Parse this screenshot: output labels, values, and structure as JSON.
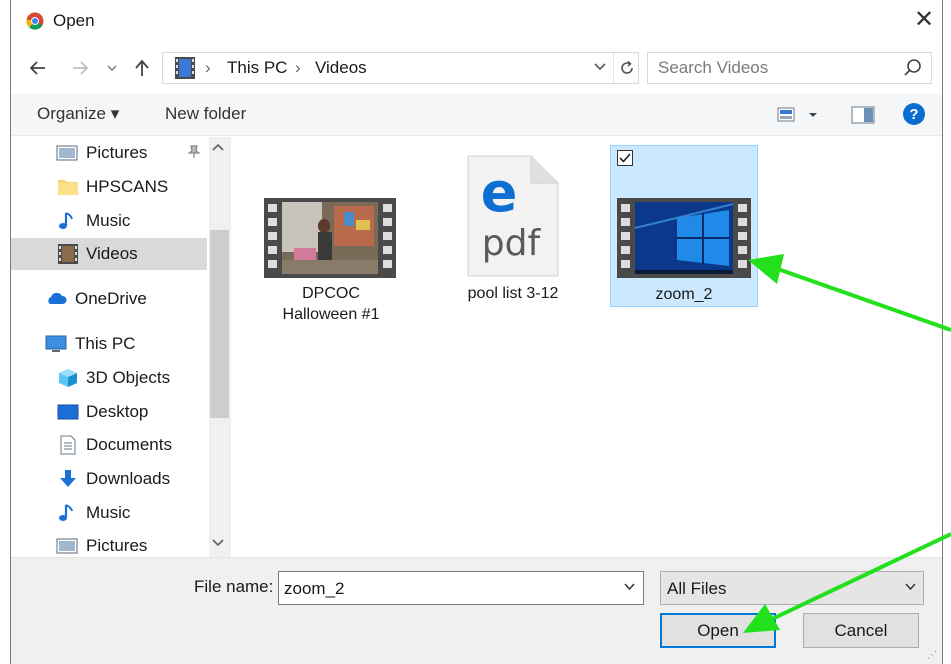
{
  "window": {
    "title": "Open",
    "close_glyph": "✕"
  },
  "nav": {
    "back_icon": "arrow-left-icon",
    "forward_icon": "arrow-right-icon",
    "recent_icon": "chevron-down-icon",
    "up_icon": "arrow-up-icon",
    "breadcrumb": [
      "This PC",
      "Videos"
    ],
    "search_placeholder": "Search Videos"
  },
  "toolbar": {
    "organize_label": "Organize ▾",
    "new_folder_label": "New folder"
  },
  "sidebar": {
    "items": [
      {
        "label": "Pictures",
        "icon": "pictures-folder-icon",
        "pinned": true
      },
      {
        "label": "HPSCANS",
        "icon": "folder-icon"
      },
      {
        "label": "Music",
        "icon": "music-note-icon"
      },
      {
        "label": "Videos",
        "icon": "film-strip-icon",
        "selected": true
      },
      {
        "label": "OneDrive",
        "icon": "cloud-icon"
      },
      {
        "label": "This PC",
        "icon": "computer-icon"
      },
      {
        "label": "3D Objects",
        "icon": "cube-icon"
      },
      {
        "label": "Desktop",
        "icon": "desktop-icon"
      },
      {
        "label": "Documents",
        "icon": "document-icon"
      },
      {
        "label": "Downloads",
        "icon": "download-arrow-icon"
      },
      {
        "label": "Music",
        "icon": "music-note-icon"
      },
      {
        "label": "Pictures",
        "icon": "pictures-folder-icon"
      }
    ]
  },
  "files": [
    {
      "name": "DPCOC Halloween #1",
      "type": "video"
    },
    {
      "name": "pool list 3-12",
      "type": "pdf",
      "icon_text": "pdf"
    },
    {
      "name": "zoom_2",
      "type": "video",
      "selected": true,
      "checked": true
    }
  ],
  "footer": {
    "filename_label": "File name:",
    "filename_value": "zoom_2",
    "filetype_value": "All Files",
    "open_label": "Open",
    "cancel_label": "Cancel"
  },
  "colors": {
    "selection": "#cce8ff",
    "selection_border": "#99d1ff",
    "primary_border": "#0078d7",
    "annotation_arrow": "#22e01c"
  }
}
